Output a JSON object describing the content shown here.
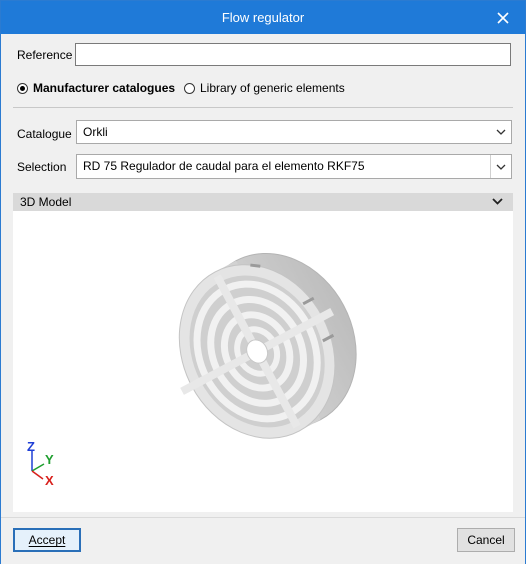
{
  "window": {
    "title": "Flow regulator"
  },
  "reference": {
    "label": "Reference",
    "value": ""
  },
  "source_options": [
    {
      "label": "Manufacturer catalogues",
      "selected": true
    },
    {
      "label": "Library of generic elements",
      "selected": false
    }
  ],
  "catalogue": {
    "label": "Catalogue",
    "value": "Orkli"
  },
  "selection": {
    "label": "Selection",
    "value": "RD 75 Regulador de caudal para el elemento RKF75"
  },
  "model_section": {
    "title": "3D Model"
  },
  "axes": {
    "z": "Z",
    "y": "Y",
    "x": "X"
  },
  "buttons": {
    "accept": "Accept",
    "cancel": "Cancel"
  },
  "colors": {
    "titlebar": "#1f7ad8",
    "axis_z": "#1f3fd6",
    "axis_y": "#1e9e2e",
    "axis_x": "#d8201c"
  }
}
